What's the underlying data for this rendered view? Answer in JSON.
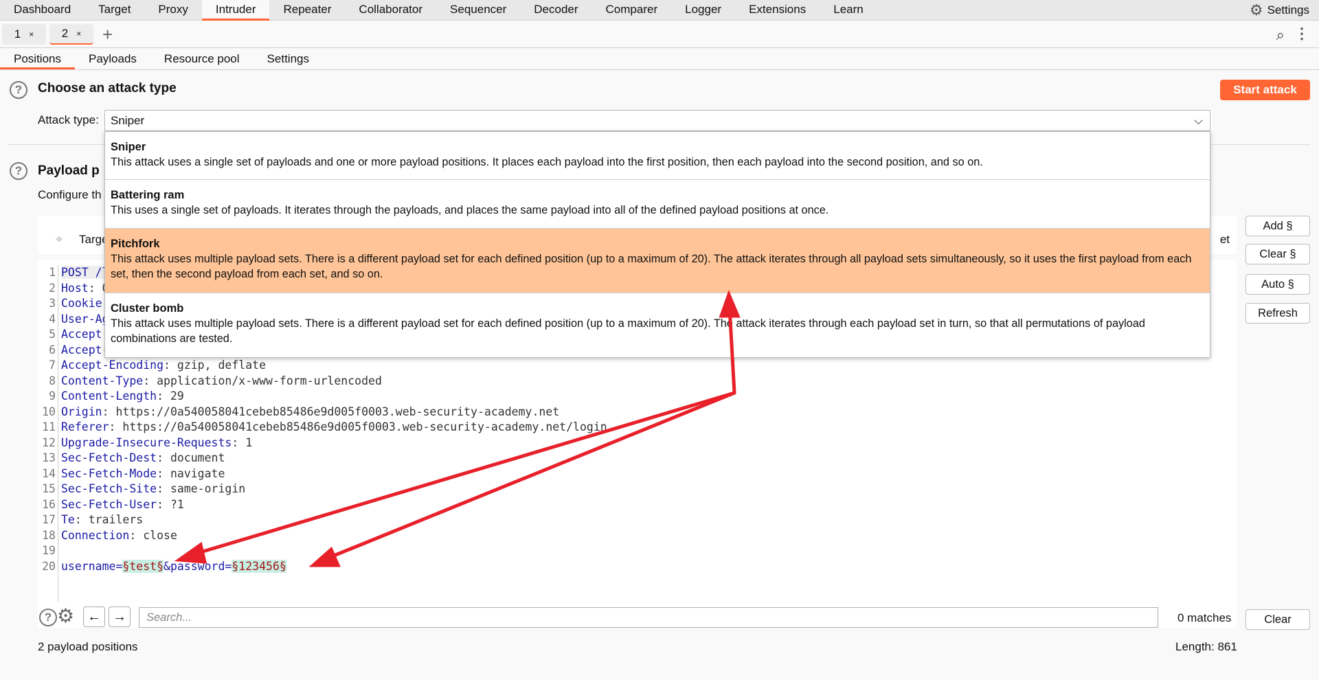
{
  "nav": {
    "items": [
      "Dashboard",
      "Target",
      "Proxy",
      "Intruder",
      "Repeater",
      "Collaborator",
      "Sequencer",
      "Decoder",
      "Comparer",
      "Logger",
      "Extensions",
      "Learn"
    ],
    "active": "Intruder",
    "settings": "Settings"
  },
  "tabs": [
    {
      "label": "1",
      "close": "×"
    },
    {
      "label": "2",
      "close": "×"
    }
  ],
  "add_tab": "+",
  "subtabs": [
    "Positions",
    "Payloads",
    "Resource pool",
    "Settings"
  ],
  "attack": {
    "heading": "Choose an attack type",
    "label": "Attack type:",
    "selected": "Sniper",
    "start": "Start attack"
  },
  "options": [
    {
      "title": "Sniper",
      "desc": "This attack uses a single set of payloads and one or more payload positions. It places each payload into the first position, then each payload into the second position, and so on."
    },
    {
      "title": "Battering ram",
      "desc": "This uses a single set of payloads. It iterates through the payloads, and places the same payload into all of the defined payload positions at once."
    },
    {
      "title": "Pitchfork",
      "desc": "This attack uses multiple payload sets. There is a different payload set for each defined position (up to a maximum of 20). The attack iterates through all payload sets simultaneously, so it uses the first payload from each set, then the second payload from each set, and so on."
    },
    {
      "title": "Cluster bomb",
      "desc": "This attack uses multiple payload sets. There is a different payload set for each defined position (up to a maximum of 20). The attack iterates through each payload set in turn, so that all permutations of payload combinations are tested."
    }
  ],
  "positions": {
    "heading": "Payload p",
    "desc": "Configure th",
    "target_label": "Targe",
    "target_right": "et"
  },
  "buttons": {
    "add": "Add §",
    "clear": "Clear §",
    "auto": "Auto §",
    "refresh": "Refresh",
    "clear_search": "Clear"
  },
  "request": [
    {
      "n": "1",
      "k": "POST /l",
      "v": ""
    },
    {
      "n": "2",
      "k": "Host",
      "v": ": 0"
    },
    {
      "n": "3",
      "k": "Cookie",
      "v": ""
    },
    {
      "n": "4",
      "k": "User-Ag",
      "v": ""
    },
    {
      "n": "5",
      "k": "Accept",
      "v": ""
    },
    {
      "n": "6",
      "k": "Accept-",
      "v": ""
    },
    {
      "n": "7",
      "k": "Accept-Encoding",
      "v": ": gzip, deflate"
    },
    {
      "n": "8",
      "k": "Content-Type",
      "v": ": application/x-www-form-urlencoded"
    },
    {
      "n": "9",
      "k": "Content-Length",
      "v": ": 29"
    },
    {
      "n": "10",
      "k": "Origin",
      "v": ": https://0a540058041cebeb85486e9d005f0003.web-security-academy.net"
    },
    {
      "n": "11",
      "k": "Referer",
      "v": ": https://0a540058041cebeb85486e9d005f0003.web-security-academy.net/login"
    },
    {
      "n": "12",
      "k": "Upgrade-Insecure-Requests",
      "v": ": 1"
    },
    {
      "n": "13",
      "k": "Sec-Fetch-Dest",
      "v": ": document"
    },
    {
      "n": "14",
      "k": "Sec-Fetch-Mode",
      "v": ": navigate"
    },
    {
      "n": "15",
      "k": "Sec-Fetch-Site",
      "v": ": same-origin"
    },
    {
      "n": "16",
      "k": "Sec-Fetch-User",
      "v": ": ?1"
    },
    {
      "n": "17",
      "k": "Te",
      "v": ": trailers"
    },
    {
      "n": "18",
      "k": "Connection",
      "v": ": close"
    },
    {
      "n": "19",
      "k": "",
      "v": ""
    }
  ],
  "body_line": {
    "n": "20",
    "p1": "username=",
    "pay1": "§test§",
    "p2": "&password=",
    "pay2": "§123456§"
  },
  "search": {
    "placeholder": "Search...",
    "matches": "0 matches"
  },
  "status": {
    "positions": "2 payload positions",
    "length": "Length: 861"
  },
  "colors": {
    "accent": "#ff6633",
    "highlight": "#ffc497",
    "arrow": "#e8202a"
  }
}
